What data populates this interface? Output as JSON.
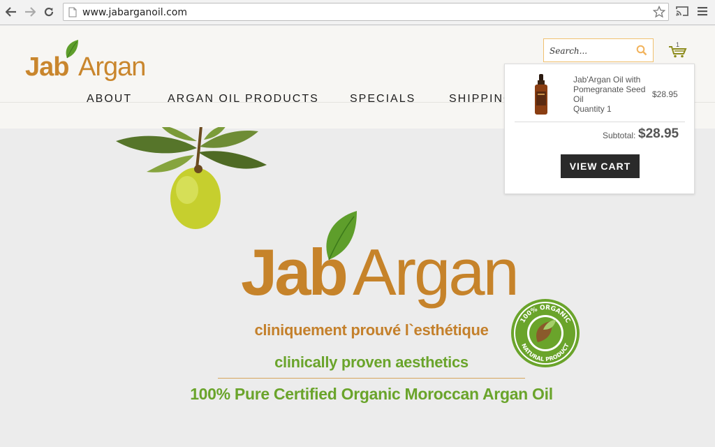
{
  "browser": {
    "url": "www.jabarganoil.com",
    "back_icon": "back-arrow-icon",
    "forward_icon": "forward-arrow-icon",
    "reload_icon": "reload-icon",
    "bookmark_icon": "star-icon",
    "cast_icon": "cast-icon",
    "menu_icon": "hamburger-menu-icon"
  },
  "header": {
    "logo": {
      "jab": "Jab",
      "argan": "Argan"
    },
    "search": {
      "placeholder": "Search..."
    },
    "cart": {
      "count": "1"
    },
    "nav": [
      {
        "label": "ABOUT"
      },
      {
        "label": "ARGAN OIL PRODUCTS"
      },
      {
        "label": "SPECIALS"
      },
      {
        "label": "SHIPPING"
      }
    ]
  },
  "hero": {
    "logo": {
      "jab": "Jab",
      "argan": "Argan"
    },
    "tagline_fr": "cliniquement prouvé l`esthétique",
    "tagline_en": "clinically proven aesthetics",
    "tagline_main": "100% Pure Certified Organic Moroccan Argan Oil",
    "seal": {
      "top_text": "100% ORGANIC",
      "bottom_text": "NATURAL PRODUCT"
    }
  },
  "cart_dropdown": {
    "item": {
      "name": "Jab'Argan Oil with Pomegranate Seed Oil",
      "quantity": "Quantity 1",
      "price": "$28.95"
    },
    "subtotal_label": "Subtotal:",
    "subtotal_value": "$28.95",
    "view_cart_label": "VIEW CART"
  },
  "colors": {
    "brand_gold": "#c6832a",
    "brand_green": "#6aa42b",
    "button_dark": "#2a2a2a"
  }
}
